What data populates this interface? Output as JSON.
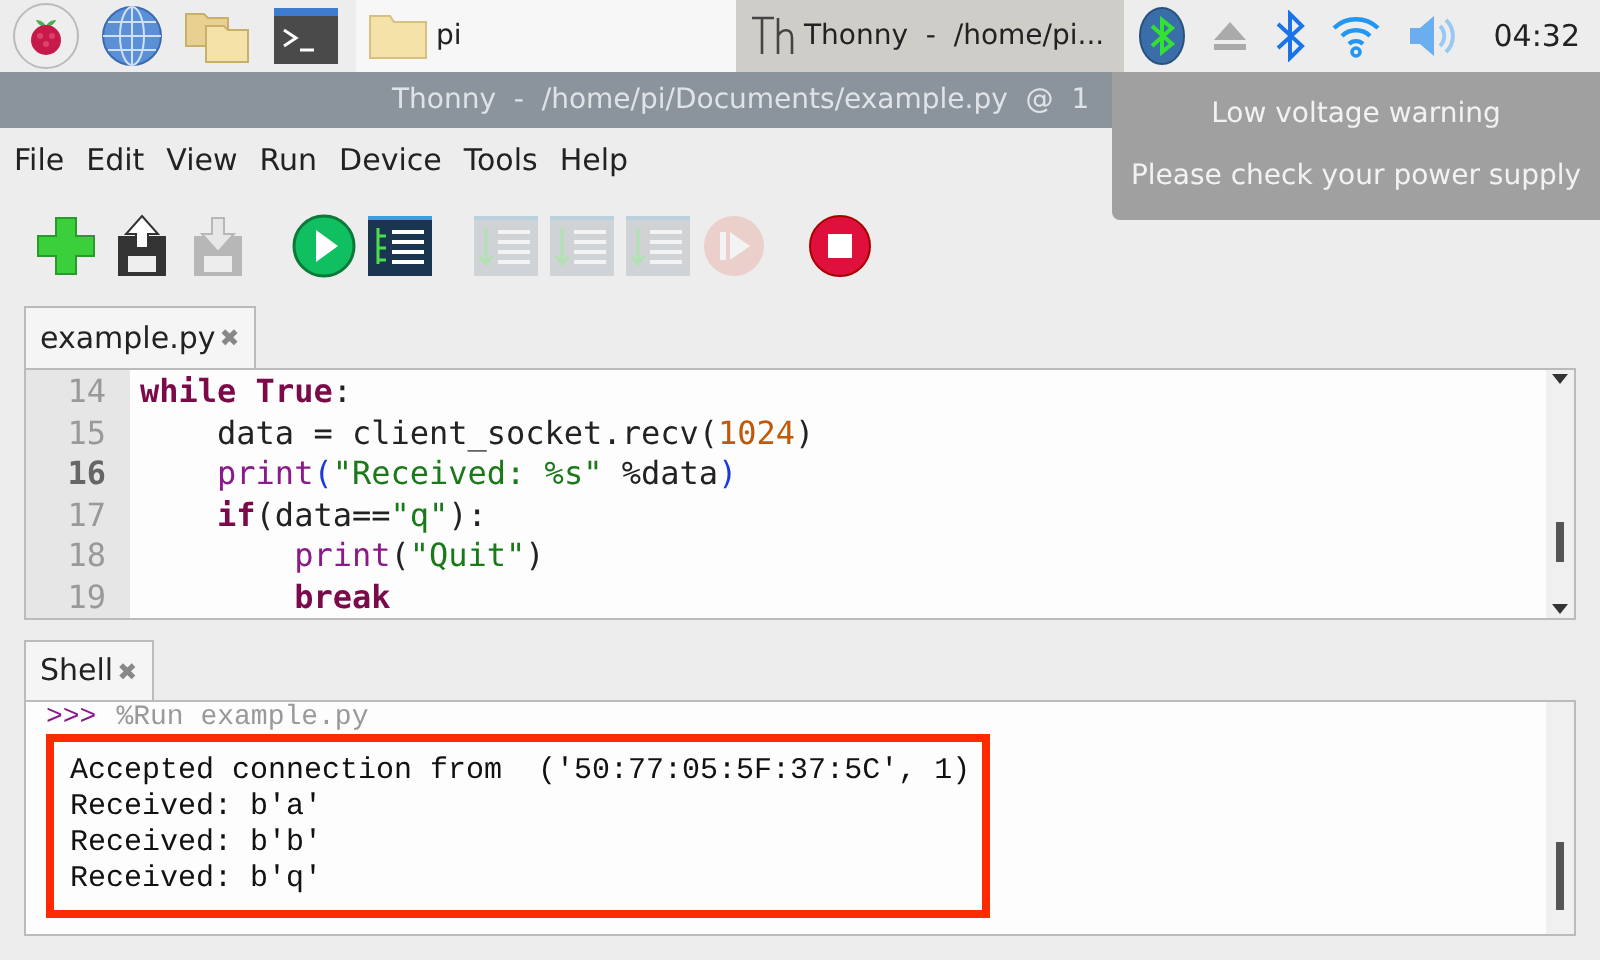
{
  "taskbar": {
    "launchers": [
      {
        "kind": "raspberry"
      },
      {
        "kind": "globe"
      },
      {
        "kind": "folders"
      },
      {
        "kind": "terminal"
      }
    ],
    "windows": [
      {
        "label": "pi",
        "kind": "folder",
        "selected": false
      },
      {
        "label": "Thonny  -  /home/pi...",
        "kind": "thonny",
        "selected": true
      }
    ],
    "tray": [
      {
        "kind": "bluetooth-badge"
      },
      {
        "kind": "eject"
      },
      {
        "kind": "bluetooth"
      },
      {
        "kind": "wifi"
      },
      {
        "kind": "volume"
      }
    ],
    "clock": "04:32"
  },
  "tooltip": {
    "title": "Low voltage warning",
    "message": "Please check your power supply"
  },
  "window": {
    "title": "Thonny  -  /home/pi/Documents/example.py  @  1"
  },
  "menu": [
    "File",
    "Edit",
    "View",
    "Run",
    "Device",
    "Tools",
    "Help"
  ],
  "toolbar": [
    {
      "kind": "new",
      "disabled": false
    },
    {
      "kind": "load",
      "disabled": false
    },
    {
      "kind": "save",
      "disabled": true
    },
    {
      "kind": "run",
      "disabled": false
    },
    {
      "kind": "debug",
      "disabled": false
    },
    {
      "kind": "step-over",
      "disabled": true
    },
    {
      "kind": "step-into",
      "disabled": true
    },
    {
      "kind": "step-out",
      "disabled": true
    },
    {
      "kind": "resume",
      "disabled": true
    },
    {
      "kind": "stop",
      "disabled": false
    }
  ],
  "editor": {
    "tab": {
      "label": "example.py",
      "close": "✖"
    },
    "lines": [
      {
        "number": "14",
        "current": false,
        "tokens": [
          {
            "text": "while",
            "kind": "keyword"
          },
          {
            "text": " True",
            "kind": "keyword"
          },
          {
            "text": ":",
            "kind": "plain"
          }
        ]
      },
      {
        "number": "15",
        "current": false,
        "tokens": [
          {
            "text": "    data = client_socket.recv(",
            "kind": "plain"
          },
          {
            "text": "1024",
            "kind": "number"
          },
          {
            "text": ")",
            "kind": "plain"
          }
        ]
      },
      {
        "number": "16",
        "current": true,
        "tokens": [
          {
            "text": "    print",
            "kind": "builtin"
          },
          {
            "text": "(",
            "kind": "paren"
          },
          {
            "text": "\"Received: %s\"",
            "kind": "string"
          },
          {
            "text": " %data",
            "kind": "plain"
          },
          {
            "text": ")",
            "kind": "paren"
          }
        ]
      },
      {
        "number": "17",
        "current": false,
        "tokens": [
          {
            "text": "    if",
            "kind": "keyword"
          },
          {
            "text": "(data==",
            "kind": "plain"
          },
          {
            "text": "\"q\"",
            "kind": "string"
          },
          {
            "text": "):",
            "kind": "plain"
          }
        ]
      },
      {
        "number": "18",
        "current": false,
        "tokens": [
          {
            "text": "        print",
            "kind": "builtin"
          },
          {
            "text": "(",
            "kind": "plain"
          },
          {
            "text": "\"Quit\"",
            "kind": "string"
          },
          {
            "text": ")",
            "kind": "plain"
          }
        ]
      },
      {
        "number": "19",
        "current": false,
        "tokens": [
          {
            "text": "        break",
            "kind": "keyword"
          }
        ]
      }
    ]
  },
  "shell": {
    "tab": {
      "label": "Shell",
      "close": "✖"
    },
    "prompt": {
      "marker": ">>>",
      "command": "%Run example.py"
    },
    "output": [
      "Accepted connection from  ('50:77:05:5F:37:5C', 1)",
      "Received: b'a'",
      "Received: b'b'",
      "Received: b'q'"
    ]
  }
}
